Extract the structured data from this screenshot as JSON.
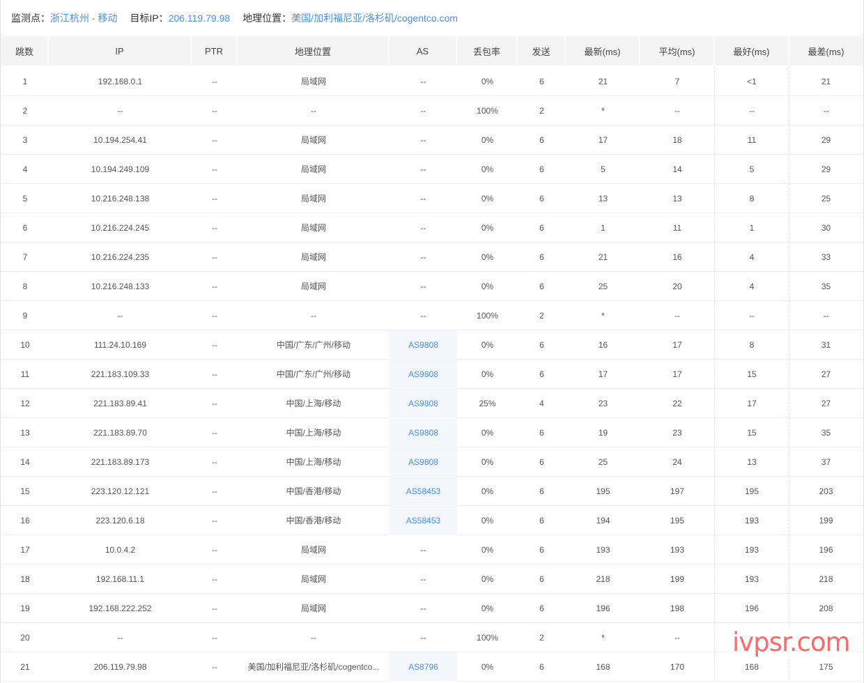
{
  "info": {
    "monitor_label": "监测点：",
    "monitor_value": "浙江杭州 - 移动",
    "target_label": "目标IP：",
    "target_value": "206.119.79.98",
    "geo_label": "地理位置：",
    "geo_value": "美国/加利福尼亚/洛杉矶/cogentco.com"
  },
  "colors": {
    "accent": "#4a90e2",
    "header_bg": "#f4f4f5",
    "as_cell_bg": "#f3f6fb",
    "watermark": "#ff5a5a"
  },
  "columns": [
    "跳数",
    "IP",
    "PTR",
    "地理位置",
    "AS",
    "丢包率",
    "发送",
    "最新(ms)",
    "平均(ms)",
    "最好(ms)",
    "最差(ms)"
  ],
  "rows": [
    {
      "hop": "1",
      "ip": "192.168.0.1",
      "ptr": "--",
      "geo": "局域网",
      "as": "--",
      "loss": "0%",
      "sent": "6",
      "last": "21",
      "avg": "7",
      "best": "<1",
      "worst": "21"
    },
    {
      "hop": "2",
      "ip": "--",
      "ptr": "--",
      "geo": "--",
      "as": "--",
      "loss": "100%",
      "sent": "2",
      "last": "*",
      "avg": "--",
      "best": "--",
      "worst": "--"
    },
    {
      "hop": "3",
      "ip": "10.194.254.41",
      "ptr": "--",
      "geo": "局域网",
      "as": "--",
      "loss": "0%",
      "sent": "6",
      "last": "17",
      "avg": "18",
      "best": "11",
      "worst": "29"
    },
    {
      "hop": "4",
      "ip": "10.194.249.109",
      "ptr": "--",
      "geo": "局域网",
      "as": "--",
      "loss": "0%",
      "sent": "6",
      "last": "5",
      "avg": "14",
      "best": "5",
      "worst": "29"
    },
    {
      "hop": "5",
      "ip": "10.216.248.138",
      "ptr": "--",
      "geo": "局域网",
      "as": "--",
      "loss": "0%",
      "sent": "6",
      "last": "13",
      "avg": "13",
      "best": "8",
      "worst": "25"
    },
    {
      "hop": "6",
      "ip": "10.216.224.245",
      "ptr": "--",
      "geo": "局域网",
      "as": "--",
      "loss": "0%",
      "sent": "6",
      "last": "1",
      "avg": "11",
      "best": "1",
      "worst": "30"
    },
    {
      "hop": "7",
      "ip": "10.216.224.235",
      "ptr": "--",
      "geo": "局域网",
      "as": "--",
      "loss": "0%",
      "sent": "6",
      "last": "21",
      "avg": "16",
      "best": "4",
      "worst": "33"
    },
    {
      "hop": "8",
      "ip": "10.216.248.133",
      "ptr": "--",
      "geo": "局域网",
      "as": "--",
      "loss": "0%",
      "sent": "6",
      "last": "25",
      "avg": "20",
      "best": "4",
      "worst": "35"
    },
    {
      "hop": "9",
      "ip": "--",
      "ptr": "--",
      "geo": "--",
      "as": "--",
      "loss": "100%",
      "sent": "2",
      "last": "*",
      "avg": "--",
      "best": "--",
      "worst": "--"
    },
    {
      "hop": "10",
      "ip": "111.24.10.169",
      "ptr": "--",
      "geo": "中国/广东/广州/移动",
      "as": "AS9808",
      "loss": "0%",
      "sent": "6",
      "last": "16",
      "avg": "17",
      "best": "8",
      "worst": "31"
    },
    {
      "hop": "11",
      "ip": "221.183.109.33",
      "ptr": "--",
      "geo": "中国/广东/广州/移动",
      "as": "AS9808",
      "loss": "0%",
      "sent": "6",
      "last": "17",
      "avg": "17",
      "best": "15",
      "worst": "27"
    },
    {
      "hop": "12",
      "ip": "221.183.89.41",
      "ptr": "--",
      "geo": "中国/上海/移动",
      "as": "AS9808",
      "loss": "25%",
      "sent": "4",
      "last": "23",
      "avg": "22",
      "best": "17",
      "worst": "27"
    },
    {
      "hop": "13",
      "ip": "221.183.89.70",
      "ptr": "--",
      "geo": "中国/上海/移动",
      "as": "AS9808",
      "loss": "0%",
      "sent": "6",
      "last": "19",
      "avg": "23",
      "best": "15",
      "worst": "35"
    },
    {
      "hop": "14",
      "ip": "221.183.89.173",
      "ptr": "--",
      "geo": "中国/上海/移动",
      "as": "AS9808",
      "loss": "0%",
      "sent": "6",
      "last": "25",
      "avg": "24",
      "best": "13",
      "worst": "37"
    },
    {
      "hop": "15",
      "ip": "223.120.12.121",
      "ptr": "--",
      "geo": "中国/香港/移动",
      "as": "AS58453",
      "loss": "0%",
      "sent": "6",
      "last": "195",
      "avg": "197",
      "best": "195",
      "worst": "203"
    },
    {
      "hop": "16",
      "ip": "223.120.6.18",
      "ptr": "--",
      "geo": "中国/香港/移动",
      "as": "AS58453",
      "loss": "0%",
      "sent": "6",
      "last": "194",
      "avg": "195",
      "best": "193",
      "worst": "199"
    },
    {
      "hop": "17",
      "ip": "10.0.4.2",
      "ptr": "--",
      "geo": "局域网",
      "as": "--",
      "loss": "0%",
      "sent": "6",
      "last": "193",
      "avg": "193",
      "best": "193",
      "worst": "196"
    },
    {
      "hop": "18",
      "ip": "192.168.11.1",
      "ptr": "--",
      "geo": "局域网",
      "as": "--",
      "loss": "0%",
      "sent": "6",
      "last": "218",
      "avg": "199",
      "best": "193",
      "worst": "218"
    },
    {
      "hop": "19",
      "ip": "192.168.222.252",
      "ptr": "--",
      "geo": "局域网",
      "as": "--",
      "loss": "0%",
      "sent": "6",
      "last": "196",
      "avg": "198",
      "best": "196",
      "worst": "208"
    },
    {
      "hop": "20",
      "ip": "--",
      "ptr": "--",
      "geo": "--",
      "as": "--",
      "loss": "100%",
      "sent": "2",
      "last": "*",
      "avg": "--",
      "best": "",
      "worst": ""
    },
    {
      "hop": "21",
      "ip": "206.119.79.98",
      "ptr": "--",
      "geo": "美国/加利福尼亚/洛杉矶/cogentco...",
      "as": "AS8796",
      "loss": "0%",
      "sent": "6",
      "last": "168",
      "avg": "170",
      "best": "168",
      "worst": "175"
    }
  ],
  "watermark": "ivpsr.com"
}
